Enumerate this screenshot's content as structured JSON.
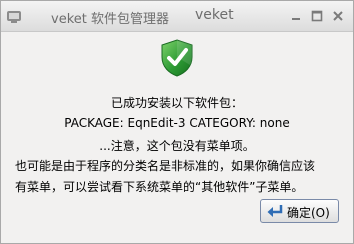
{
  "window": {
    "title": "veket 软件包管理器",
    "brand": "veket"
  },
  "titlebar_buttons": [
    "minimize-icon",
    "maximize-icon",
    "close-icon"
  ],
  "dialog": {
    "heading": "已成功安装以下软件包：",
    "package_line": "PACKAGE: EqnEdit-3 CATEGORY: none",
    "note": "...注意，这个包没有菜单项。",
    "explanation_line1": "也可能是由于程序的分类名是非标准的，如果你确信应该",
    "explanation_line2": "有菜单，可以尝试看下系统菜单的“其他软件”子菜单。",
    "ok_label": "确定(O)"
  },
  "colors": {
    "shield_green": "#2e9b35",
    "title_text": "#6e6e6e",
    "button_icon_blue": "#2f6db5"
  }
}
